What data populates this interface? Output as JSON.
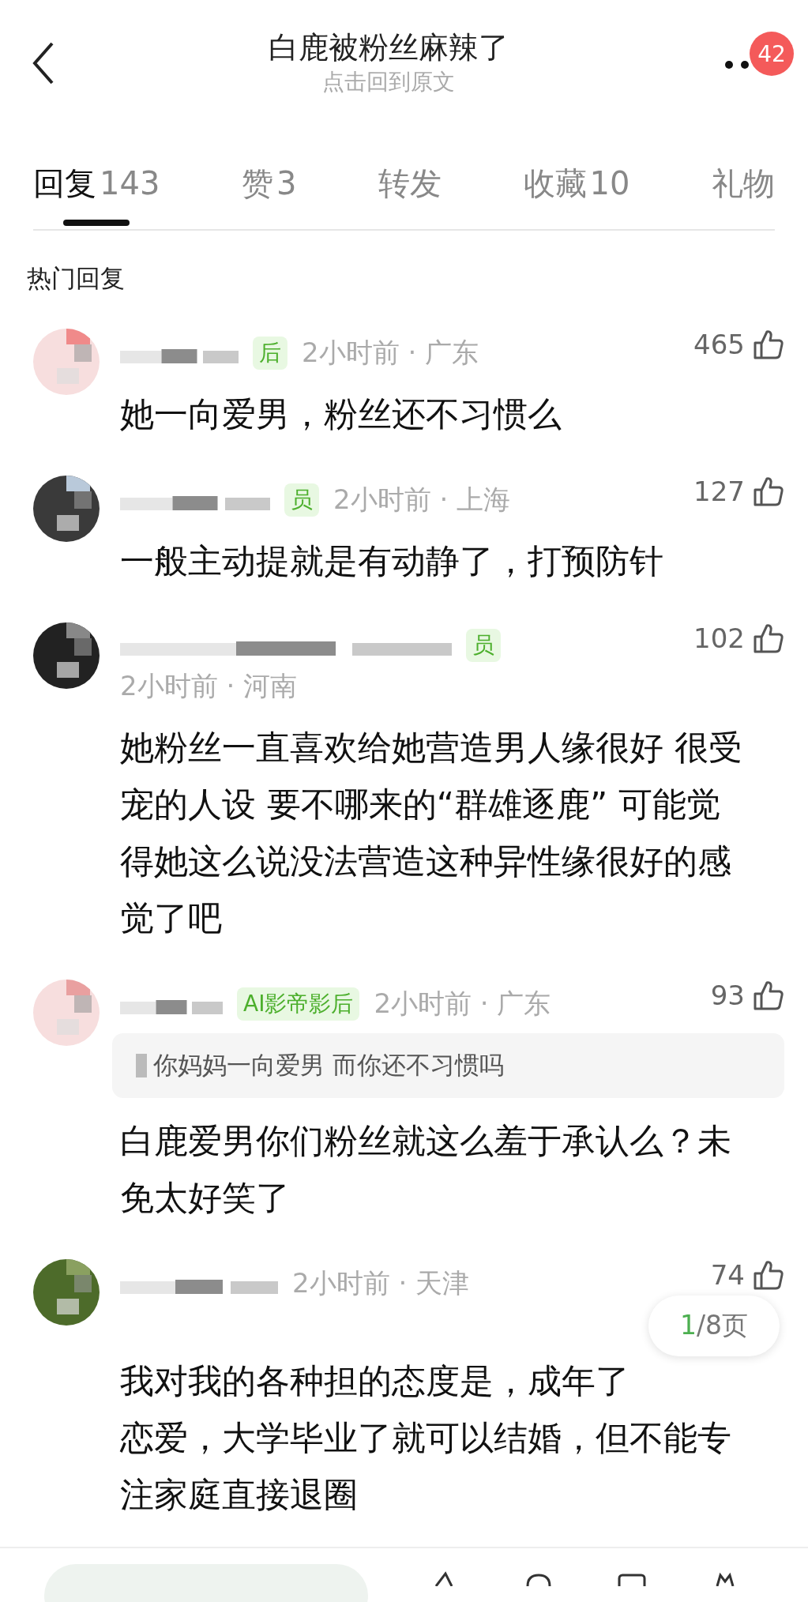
{
  "header": {
    "title": "白鹿被粉丝麻辣了",
    "subtitle": "点击回到原文",
    "badge": "42"
  },
  "tabs": [
    {
      "label": "回复",
      "count": "143",
      "selected": true
    },
    {
      "label": "赞",
      "count": "3",
      "selected": false
    },
    {
      "label": "转发",
      "selected": false
    },
    {
      "label": "收藏",
      "count": "10",
      "selected": false
    },
    {
      "label": "礼物",
      "selected": false
    }
  ],
  "section_title": "热门回复",
  "comments": [
    {
      "badge": "后",
      "time": "2小时前 · 广东",
      "likes": "465",
      "lines": [
        "她一向爱男，粉丝还不习惯么"
      ]
    },
    {
      "badge": "员",
      "time": "2小时前 · 上海",
      "likes": "127",
      "lines": [
        "一般主动提就是有动静了，打预防针"
      ]
    },
    {
      "badge": "员",
      "time": "2小时前 · 河南",
      "likes": "102",
      "lines": [
        "她粉丝一直喜欢给她营造男人缘很好 很受",
        "宠的人设 要不哪来的“群雄逐鹿” 可能觉",
        "得她这么说没法营造这种异性缘很好的感",
        "觉了吧"
      ]
    },
    {
      "badge": "AI影帝影后",
      "time": "2小时前 · 广东",
      "likes": "93",
      "quote": "你妈妈一向爱男 而你还不习惯吗",
      "lines": [
        "白鹿爱男你们粉丝就这么羞于承认么？未",
        "免太好笑了"
      ]
    },
    {
      "time": "2小时前 · 天津",
      "likes": "74",
      "lines": [
        "我对我的各种担的态度是，成年了",
        "恋爱，大学毕业了就可以结婚，但不能专",
        "注家庭直接退圈"
      ]
    }
  ],
  "pager": {
    "current": "1",
    "total": "/8页"
  }
}
